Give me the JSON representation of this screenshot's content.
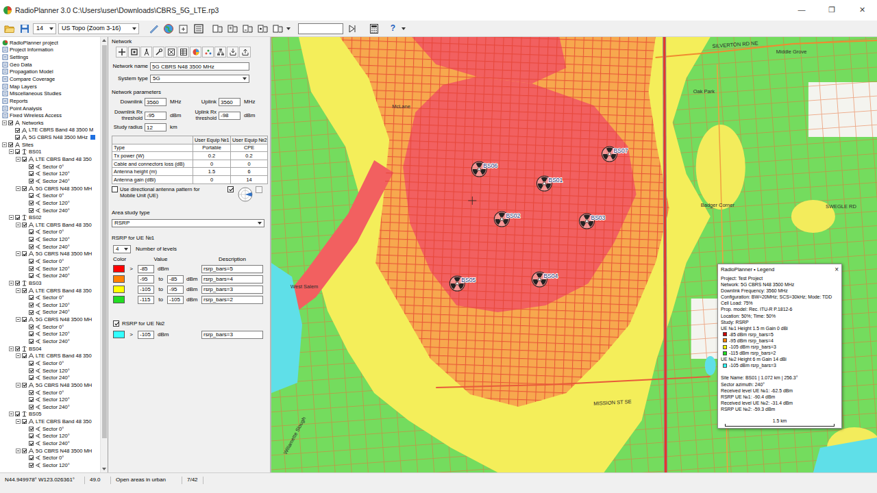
{
  "window": {
    "title": "RadioPlanner 3.0 C:\\Users\\user\\Downloads\\CBRS_5G_LTE.rp3",
    "controls": [
      "—",
      "❐",
      "✕"
    ]
  },
  "toolbar": {
    "zoom": "14",
    "basemap": "US Topo (Zoom 3-16)",
    "search": "",
    "help": "?"
  },
  "tree": [
    {
      "label": "RadioPlanner project",
      "depth": 0,
      "kind": "root",
      "selected": false
    },
    {
      "label": "Project Information",
      "depth": 0,
      "kind": "item",
      "selected": false
    },
    {
      "label": "Settings",
      "depth": 0,
      "kind": "item",
      "selected": false
    },
    {
      "label": "Geo Data",
      "depth": 0,
      "kind": "item",
      "selected": false
    },
    {
      "label": "Propagation Model",
      "depth": 0,
      "kind": "item",
      "selected": false
    },
    {
      "label": "Compare Coverage",
      "depth": 0,
      "kind": "item",
      "selected": false
    },
    {
      "label": "Map Layers",
      "depth": 0,
      "kind": "item",
      "selected": false
    },
    {
      "label": "Miscellaneous Studies",
      "depth": 0,
      "kind": "item",
      "selected": false
    },
    {
      "label": "Reports",
      "depth": 0,
      "kind": "item",
      "selected": false
    },
    {
      "label": "Point Analysis",
      "depth": 0,
      "kind": "item",
      "selected": false
    },
    {
      "label": "Fixed Wireless Access",
      "depth": 0,
      "kind": "item",
      "selected": false
    },
    {
      "label": "Networks",
      "depth": 0,
      "kind": "group",
      "expanded": true,
      "checked": true,
      "selected": false
    },
    {
      "label": "LTE CBRS Band 48 3500 M",
      "depth": 1,
      "kind": "network",
      "checked": true,
      "selected": false
    },
    {
      "label": "5G CBRS N48 3500 MHz",
      "depth": 1,
      "kind": "network",
      "checked": true,
      "selected": true
    },
    {
      "label": "Sites",
      "depth": 0,
      "kind": "group",
      "expanded": true,
      "checked": true,
      "selected": false
    },
    {
      "label": "BS01",
      "depth": 1,
      "kind": "site",
      "expanded": true,
      "checked": true,
      "selected": false
    },
    {
      "label": "LTE CBRS Band 48 350",
      "depth": 2,
      "kind": "network",
      "expanded": true,
      "checked": true,
      "selected": false
    },
    {
      "label": "Sector 0°",
      "depth": 3,
      "kind": "sector",
      "checked": true,
      "selected": false
    },
    {
      "label": "Sector 120°",
      "depth": 3,
      "kind": "sector",
      "checked": true,
      "selected": false
    },
    {
      "label": "Sector 240°",
      "depth": 3,
      "kind": "sector",
      "checked": true,
      "selected": false
    },
    {
      "label": "5G CBRS N48 3500 MH",
      "depth": 2,
      "kind": "network",
      "expanded": true,
      "checked": true,
      "selected": false
    },
    {
      "label": "Sector 0°",
      "depth": 3,
      "kind": "sector",
      "checked": true,
      "selected": false
    },
    {
      "label": "Sector 120°",
      "depth": 3,
      "kind": "sector",
      "checked": true,
      "selected": false
    },
    {
      "label": "Sector 240°",
      "depth": 3,
      "kind": "sector",
      "checked": true,
      "selected": false
    },
    {
      "label": "BS02",
      "depth": 1,
      "kind": "site",
      "expanded": true,
      "checked": true,
      "selected": false
    },
    {
      "label": "LTE CBRS Band 48 350",
      "depth": 2,
      "kind": "network",
      "expanded": true,
      "checked": true,
      "selected": false
    },
    {
      "label": "Sector 0°",
      "depth": 3,
      "kind": "sector",
      "checked": true,
      "selected": false
    },
    {
      "label": "Sector 120°",
      "depth": 3,
      "kind": "sector",
      "checked": true,
      "selected": false
    },
    {
      "label": "Sector 240°",
      "depth": 3,
      "kind": "sector",
      "checked": true,
      "selected": false
    },
    {
      "label": "5G CBRS N48 3500 MH",
      "depth": 2,
      "kind": "network",
      "expanded": true,
      "checked": true,
      "selected": false
    },
    {
      "label": "Sector 0°",
      "depth": 3,
      "kind": "sector",
      "checked": true,
      "selected": false
    },
    {
      "label": "Sector 120°",
      "depth": 3,
      "kind": "sector",
      "checked": true,
      "selected": false
    },
    {
      "label": "Sector 240°",
      "depth": 3,
      "kind": "sector",
      "checked": true,
      "selected": false
    },
    {
      "label": "BS03",
      "depth": 1,
      "kind": "site",
      "expanded": true,
      "checked": true,
      "selected": false
    },
    {
      "label": "LTE CBRS Band 48 350",
      "depth": 2,
      "kind": "network",
      "expanded": true,
      "checked": true,
      "selected": false
    },
    {
      "label": "Sector 0°",
      "depth": 3,
      "kind": "sector",
      "checked": true,
      "selected": false
    },
    {
      "label": "Sector 120°",
      "depth": 3,
      "kind": "sector",
      "checked": true,
      "selected": false
    },
    {
      "label": "Sector 240°",
      "depth": 3,
      "kind": "sector",
      "checked": true,
      "selected": false
    },
    {
      "label": "5G CBRS N48 3500 MH",
      "depth": 2,
      "kind": "network",
      "expanded": true,
      "checked": true,
      "selected": false
    },
    {
      "label": "Sector 0°",
      "depth": 3,
      "kind": "sector",
      "checked": true,
      "selected": false
    },
    {
      "label": "Sector 120°",
      "depth": 3,
      "kind": "sector",
      "checked": true,
      "selected": false
    },
    {
      "label": "Sector 240°",
      "depth": 3,
      "kind": "sector",
      "checked": true,
      "selected": false
    },
    {
      "label": "BS04",
      "depth": 1,
      "kind": "site",
      "expanded": true,
      "checked": true,
      "selected": false
    },
    {
      "label": "LTE CBRS Band 48 350",
      "depth": 2,
      "kind": "network",
      "expanded": true,
      "checked": true,
      "selected": false
    },
    {
      "label": "Sector 0°",
      "depth": 3,
      "kind": "sector",
      "checked": true,
      "selected": false
    },
    {
      "label": "Sector 120°",
      "depth": 3,
      "kind": "sector",
      "checked": true,
      "selected": false
    },
    {
      "label": "Sector 240°",
      "depth": 3,
      "kind": "sector",
      "checked": true,
      "selected": false
    },
    {
      "label": "5G CBRS N48 3500 MH",
      "depth": 2,
      "kind": "network",
      "expanded": true,
      "checked": true,
      "selected": false
    },
    {
      "label": "Sector 0°",
      "depth": 3,
      "kind": "sector",
      "checked": true,
      "selected": false
    },
    {
      "label": "Sector 120°",
      "depth": 3,
      "kind": "sector",
      "checked": true,
      "selected": false
    },
    {
      "label": "Sector 240°",
      "depth": 3,
      "kind": "sector",
      "checked": true,
      "selected": false
    },
    {
      "label": "BS05",
      "depth": 1,
      "kind": "site",
      "expanded": true,
      "checked": true,
      "selected": false
    },
    {
      "label": "LTE CBRS Band 48 350",
      "depth": 2,
      "kind": "network",
      "expanded": true,
      "checked": true,
      "selected": false
    },
    {
      "label": "Sector 0°",
      "depth": 3,
      "kind": "sector",
      "checked": true,
      "selected": false
    },
    {
      "label": "Sector 120°",
      "depth": 3,
      "kind": "sector",
      "checked": true,
      "selected": false
    },
    {
      "label": "Sector 240°",
      "depth": 3,
      "kind": "sector",
      "checked": true,
      "selected": false
    },
    {
      "label": "5G CBRS N48 3500 MH",
      "depth": 2,
      "kind": "network",
      "expanded": true,
      "checked": true,
      "selected": false
    },
    {
      "label": "Sector 0°",
      "depth": 3,
      "kind": "sector",
      "checked": true,
      "selected": false
    },
    {
      "label": "Sector 120°",
      "depth": 3,
      "kind": "sector",
      "checked": true,
      "selected": false
    }
  ],
  "form": {
    "title": "Network",
    "network_name_label": "Network name",
    "network_name": "5G CBRS N48 3500 MHz",
    "system_type_label": "System type",
    "system_type": "5G",
    "params_title": "Network parameters",
    "downlink_label": "Downlink",
    "downlink": "3560",
    "downlink_unit": "MHz",
    "uplink_label": "Uplink",
    "uplink": "3560",
    "uplink_unit": "MHz",
    "dl_rx_label": "Downlink Rx threshold",
    "dl_rx": "-95",
    "dl_rx_unit": "dBm",
    "ul_rx_label": "Uplink Rx threshold",
    "ul_rx": "-98",
    "ul_rx_unit": "dBm",
    "radius_label": "Study radius",
    "radius": "12",
    "radius_unit": "km",
    "ue_table": {
      "columns": [
        "",
        "User Equip №1",
        "User Equip №2"
      ],
      "rows": [
        [
          "Type",
          "Portable",
          "CPE"
        ],
        [
          "Tx power (W)",
          "0.2",
          "0.2"
        ],
        [
          "Cable and connectors loss (dB)",
          "0",
          "0"
        ],
        [
          "Antenna height (m)",
          "1.5",
          "6"
        ],
        [
          "Antenna gain (dBi)",
          "0",
          "14"
        ]
      ]
    },
    "directional_label": "Use directional antenna pattern for Mobile Unit (UE)",
    "directional_checked": false,
    "ue2_pattern_checked": true,
    "study_type_label": "Area study type",
    "study_type": "RSRP",
    "levels_title": "RSRP for UE №1",
    "levels_count": "4",
    "levels_count_label": "Number of levels",
    "levels_columns": [
      "Color",
      "Value",
      "Description"
    ],
    "levels": [
      {
        "kind": "above",
        "color": "#ff0000",
        "prefix": ">",
        "value": "-85",
        "unit": "dBm",
        "description": "rsrp_bars=5"
      },
      {
        "kind": "range",
        "color": "#ff8000",
        "low": "-95",
        "joiner": "to",
        "high": "-85",
        "unit": "dBm",
        "description": "rsrp_bars=4"
      },
      {
        "kind": "range",
        "color": "#ffff00",
        "low": "-105",
        "joiner": "to",
        "high": "-95",
        "unit": "dBm",
        "description": "rsrp_bars=3"
      },
      {
        "kind": "range",
        "color": "#22dd22",
        "low": "-115",
        "joiner": "to",
        "high": "-105",
        "unit": "dBm",
        "description": "rsrp_bars=2"
      }
    ],
    "ue2_title": "RSRP for UE №2",
    "ue2_checked": true,
    "ue2_level": {
      "kind": "above",
      "color": "#33ffff",
      "prefix": ">",
      "value": "-105",
      "unit": "dBm",
      "description": "rsrp_bars=3"
    }
  },
  "map": {
    "labels": [
      "SILVERTON RD NE",
      "Middle Grove",
      "Oak Park",
      "McLane",
      "Badger Corner",
      "SWEGLE RD",
      "West Salem",
      "MISSION ST SE",
      "Willamette Slough"
    ],
    "sites": [
      {
        "label": "BS06"
      },
      {
        "label": "BS01"
      },
      {
        "label": "BS07"
      },
      {
        "label": "BS02"
      },
      {
        "label": "BS03"
      },
      {
        "label": "BS05"
      },
      {
        "label": "BS04"
      }
    ]
  },
  "legend": {
    "title": "RadioPlanner • Legend",
    "close": "×",
    "info": [
      "Project: Test Project",
      "Network: 5G CBRS N48 3500 MHz",
      "Downlink Frequency: 3560 MHz",
      "Configuration: BW=20MHz; SCS=30kHz; Mode: TDD",
      "Cell Load: 75%",
      "Prop. model: Rec. ITU-R P.1812-6",
      "Location: 50%; Time: 50%",
      "Study: RSRP"
    ],
    "ue1": {
      "title": "UE №1 Height 1.5 m Gain 0 dBi",
      "entries": [
        {
          "color": "#cc0000",
          "text": "-85 dBm rsrp_bars=5"
        },
        {
          "color": "#ff8000",
          "text": "-95 dBm rsrp_bars=4"
        },
        {
          "color": "#ffff00",
          "text": "-105 dBm rsrp_bars=3"
        },
        {
          "color": "#22dd22",
          "text": "-115 dBm rsrp_bars=2"
        }
      ]
    },
    "ue2": {
      "title": "UE №2 Height 6 m Gain 14 dBi",
      "entries": [
        {
          "color": "#33ffff",
          "text": "-105 dBm rsrp_bars=3"
        }
      ]
    },
    "site_info": [
      "Site Name: BS01 | 1.072 km | 256.3°",
      "Sector azimuth: 240°",
      "Received level UE №1: -62.5 dBm",
      "RSRP UE №1: -90.4 dBm",
      "Received level UE №2: -31.4 dBm",
      "RSRP UE №2: -59.3 dBm"
    ],
    "scale": "1.5 km"
  },
  "status": [
    "N44.949978° W123.026361°",
    "49.0",
    "Open areas in urban",
    "7/42"
  ]
}
